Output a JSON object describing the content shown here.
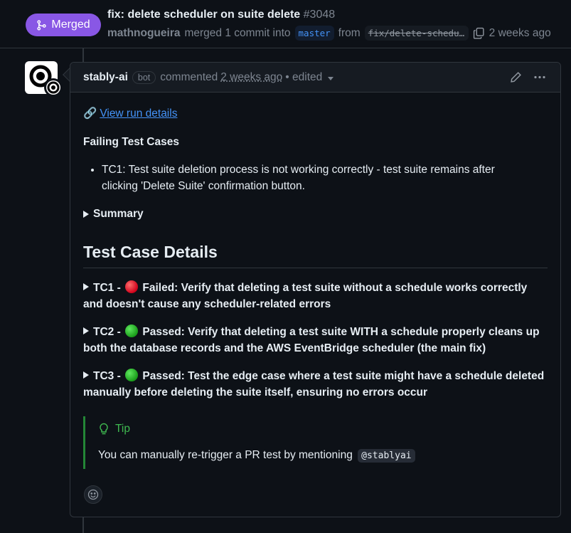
{
  "header": {
    "status_badge": "Merged",
    "title": "fix: delete scheduler on suite delete",
    "pr_number": "#3048",
    "author": "mathnogueira",
    "merged_text": "merged 1 commit into",
    "base_branch": "master",
    "from_text": "from",
    "head_branch": "fix/delete-scheduler-on-suite-delete",
    "time": "2 weeks ago",
    "badge_color": "#8957e5"
  },
  "comment": {
    "author": "stably-ai",
    "bot_label": "bot",
    "action": "commented",
    "time": "2 weeks ago",
    "edited": "• edited",
    "run_link_icon": "🔗",
    "run_link": "View run details",
    "failing_title": "Failing Test Cases",
    "failing_items": [
      "TC1: Test suite deletion process is not working correctly - test suite remains after clicking 'Delete Suite' confirmation button."
    ],
    "summary_label": "Summary",
    "details_heading": "Test Case Details",
    "test_cases": [
      {
        "id": "TC1 -",
        "status": "failed",
        "text": "Failed: Verify that deleting a test suite without a schedule works correctly and doesn't cause any scheduler-related errors"
      },
      {
        "id": "TC2 -",
        "status": "passed",
        "text": "Passed: Verify that deleting a test suite WITH a schedule properly cleans up both the database records and the AWS EventBridge scheduler (the main fix)"
      },
      {
        "id": "TC3 -",
        "status": "passed",
        "text": "Passed: Test the edge case where a test suite might have a schedule deleted manually before deleting the suite itself, ensuring no errors occur"
      }
    ],
    "tip_title": "Tip",
    "tip_text": "You can manually re-trigger a PR test by mentioning",
    "tip_mention": "@stablyai",
    "status_colors": {
      "failed": "#d0021b",
      "passed": "#1a9c1a",
      "tip": "#3fb950"
    }
  }
}
